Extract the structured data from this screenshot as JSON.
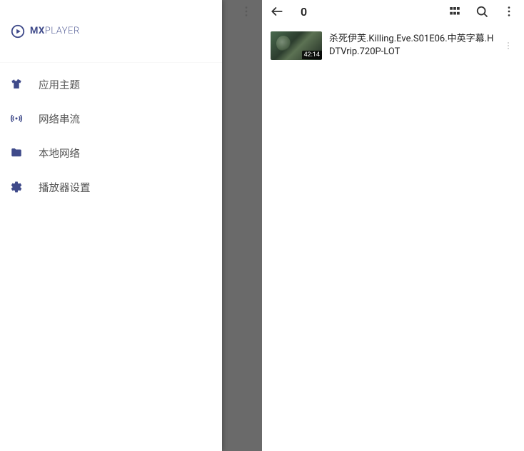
{
  "app": {
    "logo_primary": "MX",
    "logo_secondary": "PLAYER"
  },
  "drawer": {
    "items": [
      {
        "label": "应用主题"
      },
      {
        "label": "网络串流"
      },
      {
        "label": "本地网络"
      },
      {
        "label": "播放器设置"
      }
    ]
  },
  "toolbar": {
    "title": "0"
  },
  "videos": [
    {
      "title": "杀死伊芙.Killing.Eve.S01E06.中英字幕.HDTVrip.720P-LOT",
      "duration": "42:14"
    }
  ]
}
